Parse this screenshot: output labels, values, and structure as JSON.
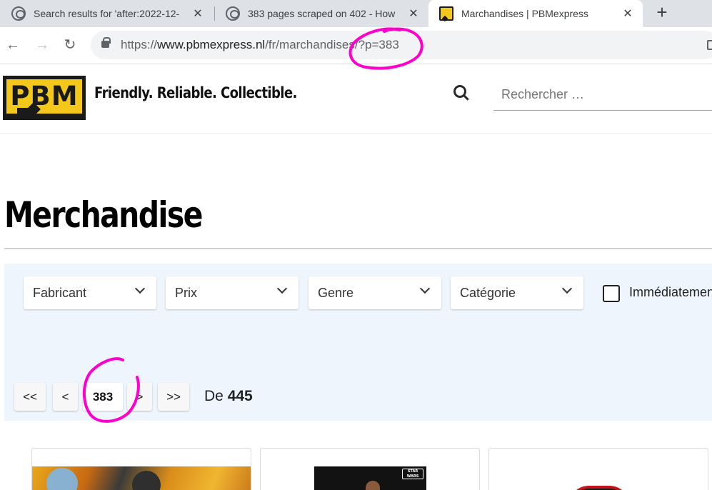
{
  "browser": {
    "tabs": [
      {
        "title": "Search results for 'after:2022-12-",
        "active": false
      },
      {
        "title": "383 pages scraped on 402 - How",
        "active": false
      },
      {
        "title": "Marchandises | PBMexpress",
        "active": true
      }
    ],
    "url_prefix": "https://",
    "url_host": "www.pbmexpress.nl",
    "url_path": "/fr/marchandises/?p=383"
  },
  "site": {
    "logo_text": "PBM",
    "tagline": "Friendly. Reliable. Collectible.",
    "search_placeholder": "Rechercher …"
  },
  "page": {
    "title": "Merchandise"
  },
  "filters": {
    "dropdowns": [
      "Fabricant",
      "Prix",
      "Genre",
      "Catégorie"
    ],
    "checkbox_label": "Immédiatement"
  },
  "pagination": {
    "first": "<<",
    "prev": "<",
    "current": "383",
    "next": ">",
    "last": ">>",
    "of_label": "De",
    "total": "445"
  },
  "products": {
    "badge_text": "STAR WARS"
  },
  "colors": {
    "annotation": "#ff00cc",
    "brand_yellow": "#f3c81b",
    "filter_bg": "#eef5fd"
  }
}
